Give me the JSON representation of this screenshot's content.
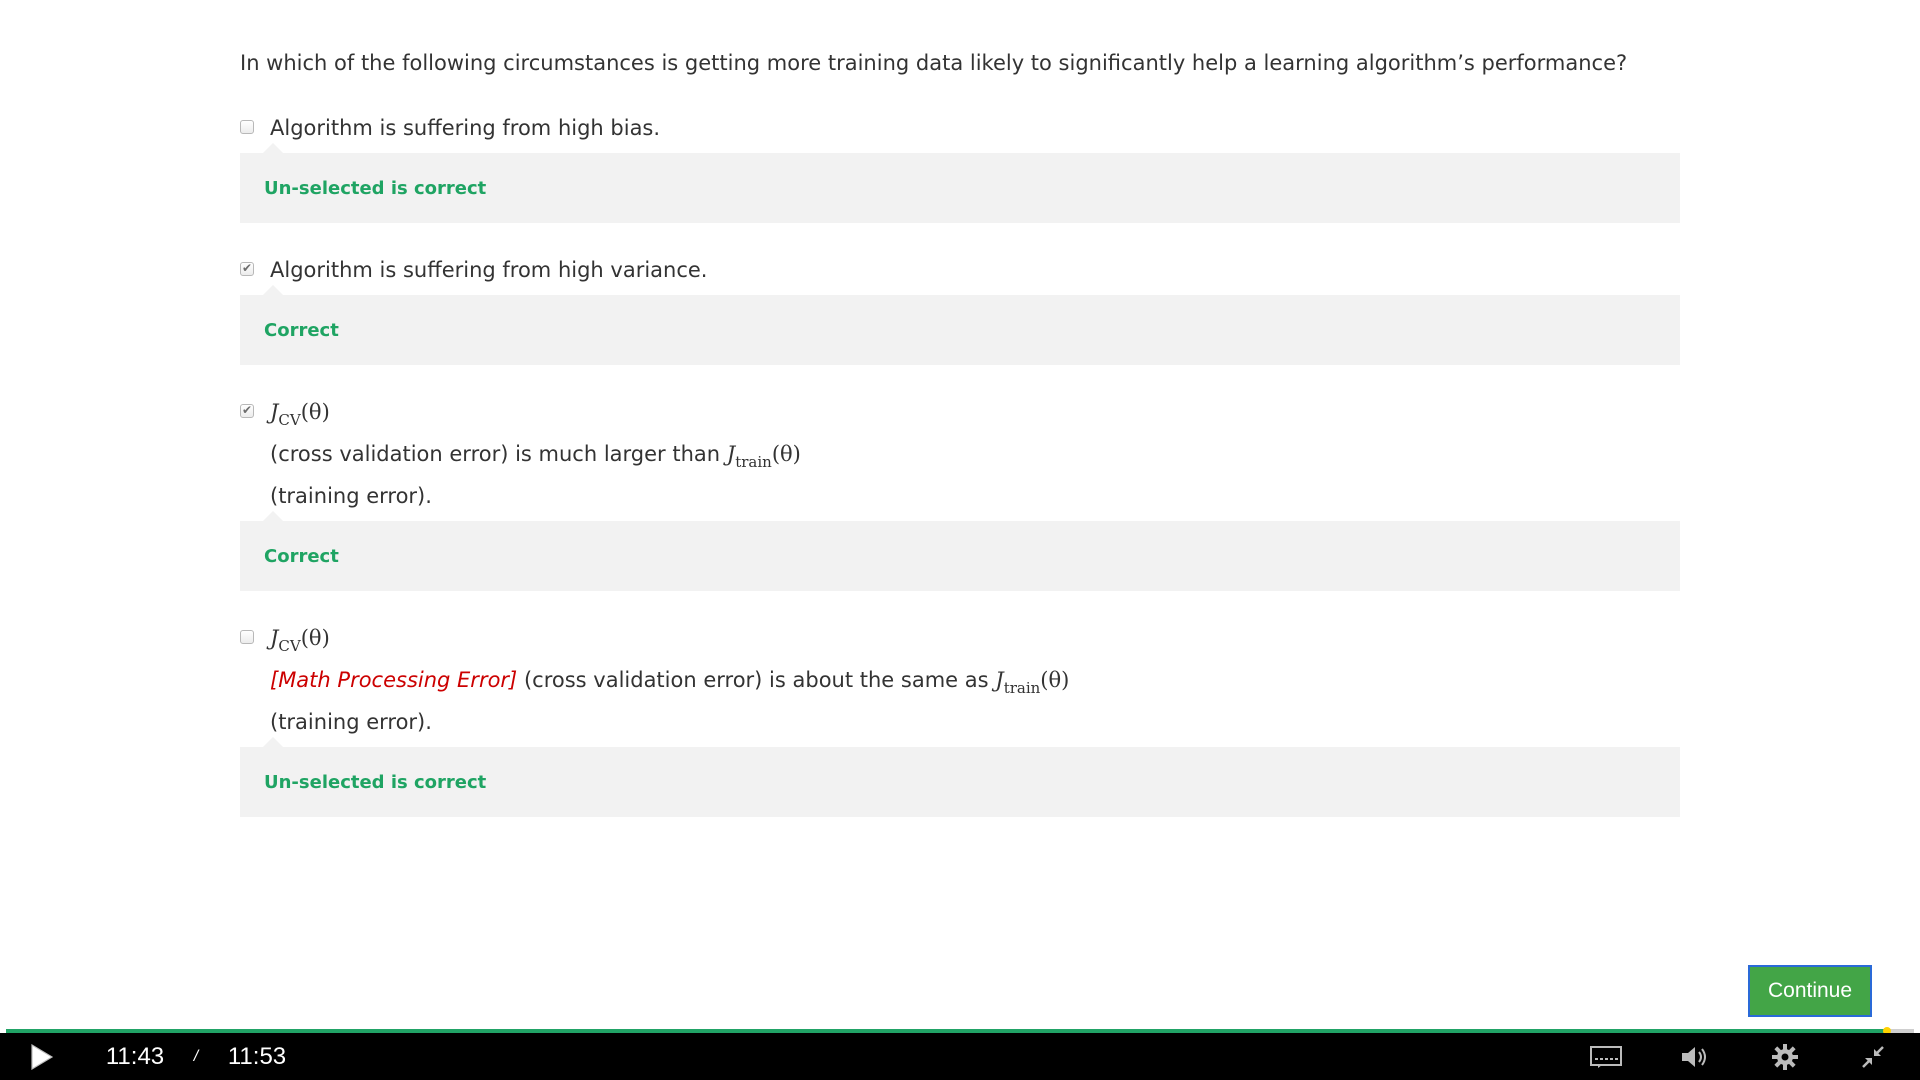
{
  "question": {
    "text": "In which of the following circumstances is getting more training data likely to significantly help a learning algorithm’s performance?"
  },
  "options": [
    {
      "text": "Algorithm is suffering from high bias.",
      "checked": false,
      "feedback": "Un-selected is correct"
    },
    {
      "text": "Algorithm is suffering from high variance.",
      "checked": true,
      "feedback": "Correct"
    },
    {
      "math_symbol": "J",
      "math_sub": "CV",
      "math_arg": "(θ)",
      "text_mid": "(cross validation error) is much larger than",
      "math2_symbol": "J",
      "math2_sub": "train",
      "math2_arg": "(θ)",
      "text_end": "(training error).",
      "checked": true,
      "feedback": "Correct"
    },
    {
      "math_symbol": "J",
      "math_sub": "CV",
      "math_arg": "(θ)",
      "error_text": "[Math Processing Error]",
      "text_mid": "(cross validation error) is about the same as",
      "math2_symbol": "J",
      "math2_sub": "train",
      "math2_arg": "(θ)",
      "text_end": "(training error).",
      "checked": false,
      "feedback": "Un-selected is correct"
    }
  ],
  "continue_button": {
    "label": "Continue",
    "color": "#43a547"
  },
  "player": {
    "current_time": "11:43",
    "separator": "/",
    "duration": "11:53",
    "progress_fraction": 0.986,
    "play_icon": "play-icon",
    "captions_icon": "captions-icon",
    "volume_icon": "volume-icon",
    "settings_icon": "gear-icon",
    "exit_fullscreen_icon": "exit-fullscreen-icon"
  }
}
